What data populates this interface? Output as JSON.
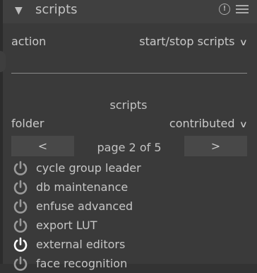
{
  "header": {
    "title": "scripts",
    "info_icon": "info-icon",
    "menu_icon": "hamburger-menu-icon"
  },
  "action": {
    "label": "action",
    "value": "start/stop scripts"
  },
  "section": {
    "title": "scripts"
  },
  "folder": {
    "label": "folder",
    "value": "contributed"
  },
  "pager": {
    "prev_label": "<",
    "next_label": ">",
    "page_text": "page 2 of 5"
  },
  "scripts": [
    {
      "label": "cycle group leader",
      "active": false
    },
    {
      "label": "db maintenance",
      "active": false
    },
    {
      "label": "enfuse advanced",
      "active": false
    },
    {
      "label": "export LUT",
      "active": false
    },
    {
      "label": "external editors",
      "active": true
    },
    {
      "label": "face recognition",
      "active": false
    }
  ],
  "colors": {
    "background": "#3a3a3a",
    "button": "#484848",
    "power_inactive": "#9a9a9a",
    "power_active": "#ffffff"
  }
}
